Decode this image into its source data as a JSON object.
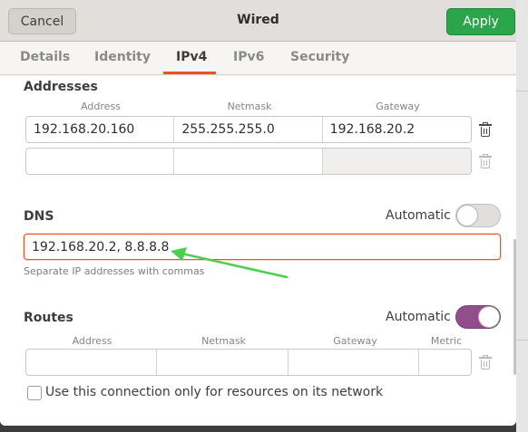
{
  "window": {
    "title": "Wired"
  },
  "header": {
    "cancel_label": "Cancel",
    "apply_label": "Apply"
  },
  "tabs": [
    {
      "label": "Details"
    },
    {
      "label": "Identity"
    },
    {
      "label": "IPv4"
    },
    {
      "label": "IPv6"
    },
    {
      "label": "Security"
    }
  ],
  "active_tab": "IPv4",
  "addresses": {
    "title": "Addresses",
    "columns": [
      "Address",
      "Netmask",
      "Gateway"
    ],
    "rows": [
      [
        "192.168.20.160",
        "255.255.255.0",
        "192.168.20.2"
      ],
      [
        "",
        "",
        ""
      ]
    ]
  },
  "dns": {
    "title": "DNS",
    "automatic_label": "Automatic",
    "automatic_on": false,
    "value": "192.168.20.2, 8.8.8.8",
    "hint": "Separate IP addresses with commas"
  },
  "routes": {
    "title": "Routes",
    "automatic_label": "Automatic",
    "automatic_on": true,
    "columns": [
      "Address",
      "Netmask",
      "Gateway",
      "Metric"
    ],
    "rows": [
      [
        "",
        "",
        "",
        ""
      ]
    ]
  },
  "options": {
    "only_resources_label": "Use this connection only for resources on its network",
    "only_resources_checked": false
  },
  "colors": {
    "apply_green": "#2aa549",
    "tab_accent": "#e95420",
    "toggle_on": "#924d8b",
    "annotation_arrow": "#4cd04c"
  },
  "icons": {
    "row_delete": "trash-icon",
    "annotation": "arrow-annotation"
  }
}
